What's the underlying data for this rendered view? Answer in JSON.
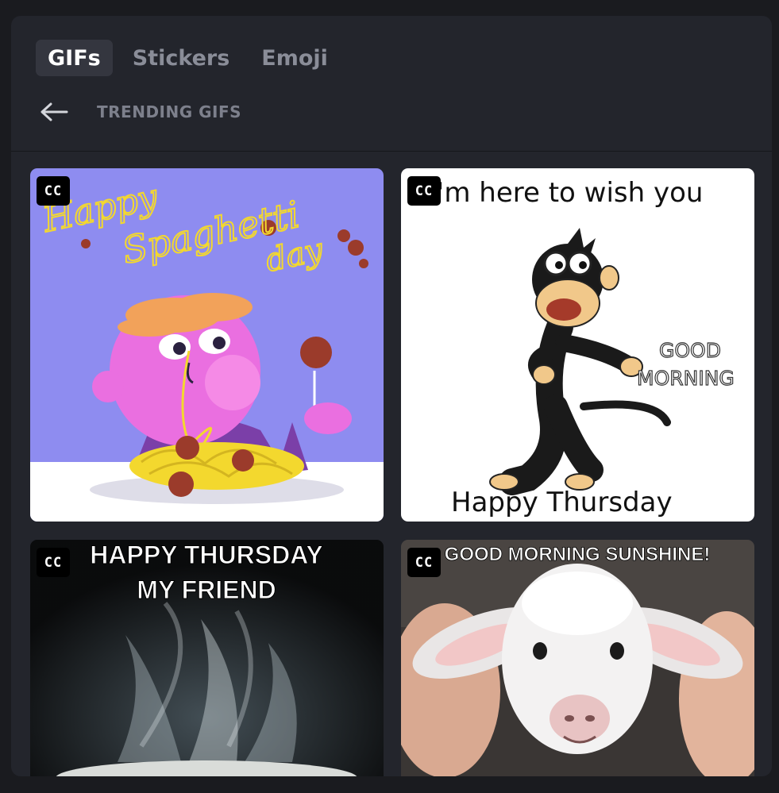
{
  "tabs": [
    {
      "label": "GIFs",
      "active": true
    },
    {
      "label": "Stickers",
      "active": false
    },
    {
      "label": "Emoji",
      "active": false
    }
  ],
  "subheader": {
    "back_icon": "arrow-left-icon",
    "title": "TRENDING GIFS"
  },
  "gifs": [
    {
      "badge": "CC",
      "caption_line1": "Happy",
      "caption_line2": "Spaghetti",
      "caption_line3": "day"
    },
    {
      "badge": "CC",
      "caption_top": "I'm here to wish you",
      "caption_right_line1": "GOOD",
      "caption_right_line2": "MORNING",
      "caption_bottom": "Happy Thursday"
    },
    {
      "badge": "CC",
      "caption_line1": "HAPPY THURSDAY",
      "caption_line2": "MY FRIEND"
    },
    {
      "badge": "CC",
      "caption_top": "GOOD MORNING SUNSHINE!"
    }
  ],
  "colors": {
    "panel": "#23252c",
    "active_tab": "#34363f",
    "page_bg": "#1a1b1f"
  }
}
